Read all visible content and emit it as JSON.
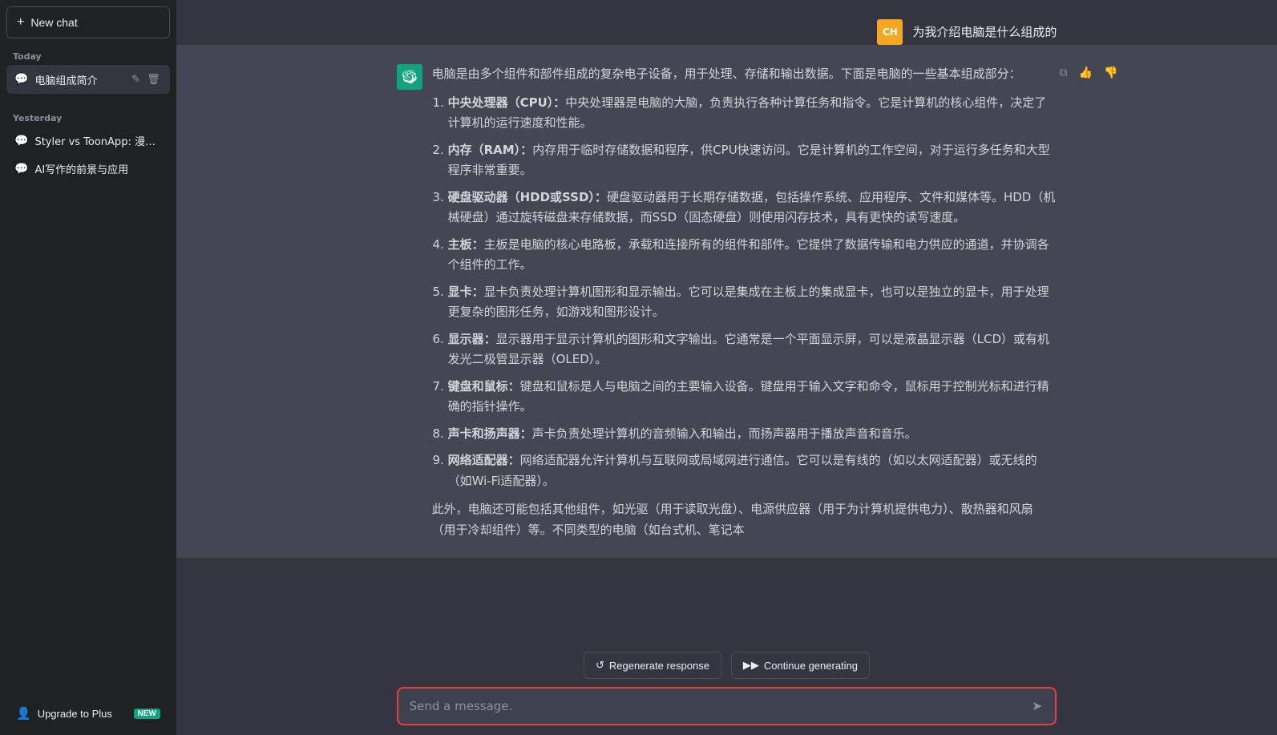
{
  "sidebar": {
    "new_chat_label": "New chat",
    "today_label": "Today",
    "yesterday_label": "Yesterday",
    "today_chats": [
      {
        "id": "chat-1",
        "label": "电脑组成简介",
        "active": true
      }
    ],
    "yesterday_chats": [
      {
        "id": "chat-2",
        "label": "Styler vs ToonApp: 漫画脸优..."
      },
      {
        "id": "chat-3",
        "label": "AI写作的前景与应用"
      }
    ],
    "upgrade_label": "Upgrade to Plus",
    "new_badge": "NEW",
    "edit_icon": "✎",
    "delete_icon": "🗑"
  },
  "header": {
    "user_avatar_text": "CH",
    "user_question": "为我介绍电脑是什么组成的"
  },
  "assistant": {
    "intro": "电脑是由多个组件和部件组成的复杂电子设备，用于处理、存储和输出数据。下面是电脑的一些基本组成部分：",
    "items": [
      {
        "title": "中央处理器（CPU）",
        "content": "中央处理器是电脑的大脑，负责执行各种计算任务和指令。它是计算机的核心组件，决定了计算机的运行速度和性能。"
      },
      {
        "title": "内存（RAM）",
        "content": "内存用于临时存储数据和程序，供CPU快速访问。它是计算机的工作空间，对于运行多任务和大型程序非常重要。"
      },
      {
        "title": "硬盘驱动器（HDD或SSD）",
        "content": "硬盘驱动器用于长期存储数据，包括操作系统、应用程序、文件和媒体等。HDD（机械硬盘）通过旋转磁盘来存储数据，而SSD（固态硬盘）则使用闪存技术，具有更快的读写速度。"
      },
      {
        "title": "主板",
        "content": "主板是电脑的核心电路板，承载和连接所有的组件和部件。它提供了数据传输和电力供应的通道，并协调各个组件的工作。"
      },
      {
        "title": "显卡",
        "content": "显卡负责处理计算机图形和显示输出。它可以是集成在主板上的集成显卡，也可以是独立的显卡，用于处理更复杂的图形任务，如游戏和图形设计。"
      },
      {
        "title": "显示器",
        "content": "显示器用于显示计算机的图形和文字输出。它通常是一个平面显示屏，可以是液晶显示器（LCD）或有机发光二极管显示器（OLED）。"
      },
      {
        "title": "键盘和鼠标",
        "content": "键盘和鼠标是人与电脑之间的主要输入设备。键盘用于输入文字和命令，鼠标用于控制光标和进行精确的指针操作。"
      },
      {
        "title": "声卡和扬声器",
        "content": "声卡负责处理计算机的音频输入和输出，而扬声器用于播放声音和音乐。"
      },
      {
        "title": "网络适配器",
        "content": "网络适配器允许计算机与互联网或局域网进行通信。它可以是有线的（如以太网适配器）或无线的（如Wi-Fi适配器）。"
      }
    ],
    "footer": "此外，电脑还可能包括其他组件，如光驱（用于读取光盘）、电源供应器（用于为计算机提供电力）、散热器和风扇（用于冷却组件）等。不同类型的电脑（如台式机、笔记本"
  },
  "toolbar": {
    "copy_icon": "⧉",
    "thumbup_icon": "👍",
    "thumbdown_icon": "👎"
  },
  "bottom": {
    "regenerate_label": "Regenerate response",
    "continue_label": "Continue generating",
    "input_placeholder": "Send a message.",
    "send_icon": "➤"
  }
}
